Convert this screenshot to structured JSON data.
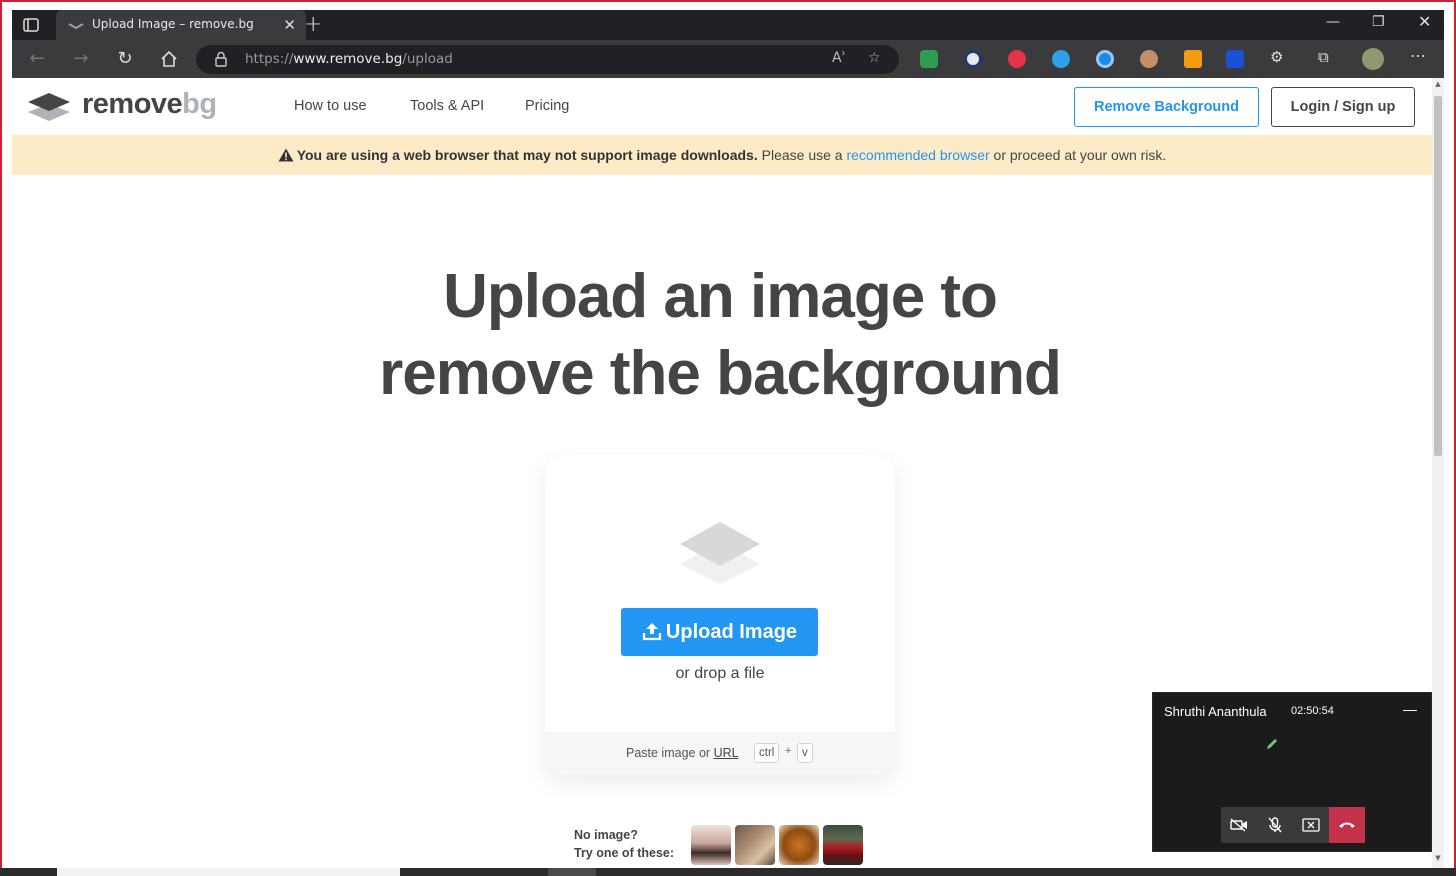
{
  "browser": {
    "tab_title": "Upload Image – remove.bg",
    "url_prefix": "https://",
    "url_domain": "www.remove.bg",
    "url_path": "/upload",
    "read_aloud_label": "Aʾ"
  },
  "nav": {
    "logo_main": "remove",
    "logo_accent": "bg",
    "links": [
      "How to use",
      "Tools & API",
      "Pricing"
    ],
    "remove_bg_button": "Remove Background",
    "login_button": "Login / Sign up"
  },
  "warning": {
    "bold": "You are using a web browser that may not support image downloads.",
    "text1": "Please use a",
    "link": "recommended browser",
    "text2": "or proceed at your own risk."
  },
  "hero": {
    "line1": "Upload an image to",
    "line2": "remove the background"
  },
  "upload": {
    "button": "Upload Image",
    "drop": "or drop a file",
    "paste": "Paste image or",
    "url_link": "URL",
    "key1": "ctrl",
    "plus": "+",
    "key2": "v"
  },
  "samples": {
    "line1": "No image?",
    "line2": "Try one of these:"
  },
  "call": {
    "name": "Shruthi Ananthula",
    "duration": "02:50:54"
  },
  "colors": {
    "accent": "#2196f3",
    "warning_bg": "#fdebc8",
    "text": "#454545",
    "hangup": "#c4314b"
  }
}
